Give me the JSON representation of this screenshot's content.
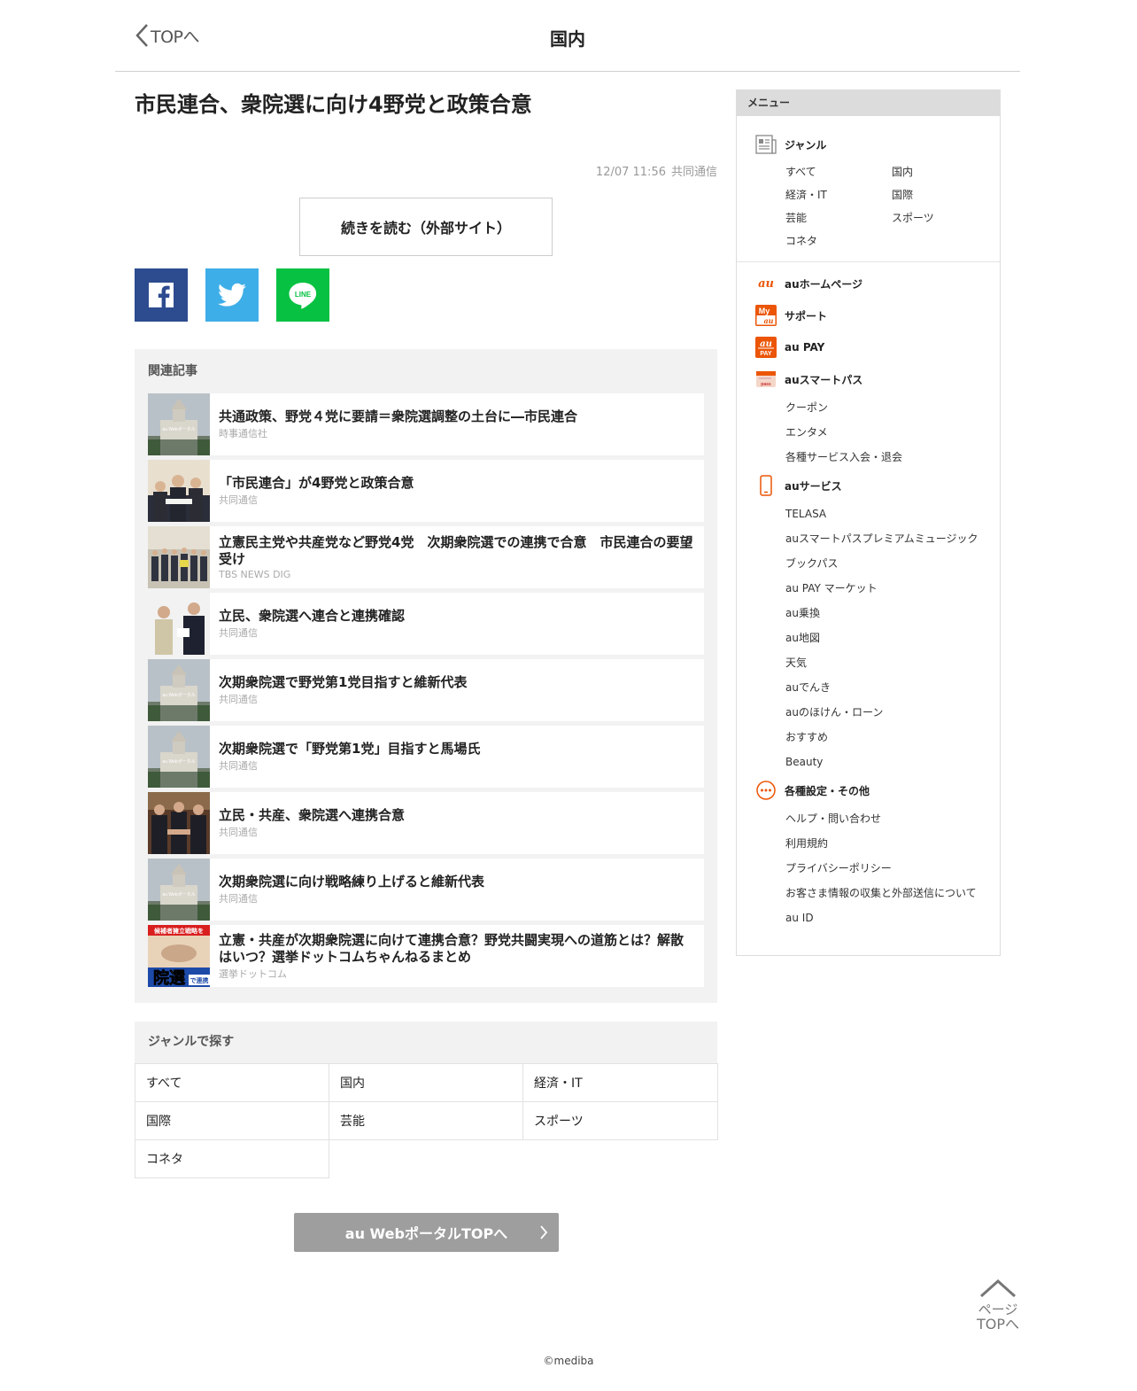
{
  "header": {
    "back_label": "TOPへ",
    "title": "国内"
  },
  "article": {
    "title": "市民連合、衆院選に向け4野党と政策合意",
    "date": "12/07 11:56",
    "source": "共同通信",
    "read_more": "続きを読む（外部サイト）"
  },
  "share": {
    "line_label": "LINE"
  },
  "related": {
    "heading": "関連記事",
    "items": [
      {
        "title": "共通政策、野党４党に要請＝衆院選調整の土台に―市民連合",
        "source": "時事通信社",
        "thumb": "diet"
      },
      {
        "title": "「市民連合」が4野党と政策合意",
        "source": "共同通信",
        "thumb": "people"
      },
      {
        "title": "立憲民主党や共産党など野党4党　次期衆院選での連携で合意　市民連合の要望受け",
        "source": "TBS NEWS DIG",
        "thumb": "group"
      },
      {
        "title": "立民、衆院選へ連合と連携確認",
        "source": "共同通信",
        "thumb": "two"
      },
      {
        "title": "次期衆院選で野党第1党目指すと維新代表",
        "source": "共同通信",
        "thumb": "diet"
      },
      {
        "title": "次期衆院選で「野党第1党」目指すと馬場氏",
        "source": "共同通信",
        "thumb": "diet"
      },
      {
        "title": "立民・共産、衆院選へ連携合意",
        "source": "共同通信",
        "thumb": "handshake"
      },
      {
        "title": "次期衆院選に向け戦略練り上げると維新代表",
        "source": "共同通信",
        "thumb": "diet"
      },
      {
        "title": "立憲・共産が次期衆院選に向けて連携合意？野党共闘実現への道筋とは？解散はいつ？選挙ドットコムちゃんねるまとめ",
        "source": "選挙ドットコム",
        "thumb": "senkyo"
      }
    ],
    "thumb_overlay": "au Webポータル",
    "senkyo_top": "候補者擁立戦略を",
    "senkyo_bottom": "院選",
    "senkyo_tag": "で連携"
  },
  "genre_section": {
    "heading": "ジャンルで探す",
    "cells": [
      "すべて",
      "国内",
      "経済・IT",
      "国際",
      "芸能",
      "スポーツ",
      "コネタ"
    ]
  },
  "portal_button": "au WebポータルTOPへ",
  "sidebar": {
    "heading": "メニュー",
    "genre_title": "ジャンル",
    "genres": [
      "すべて",
      "国内",
      "経済・IT",
      "国際",
      "芸能",
      "スポーツ",
      "コネタ"
    ],
    "links": {
      "homepage": "auホームページ",
      "support": "サポート",
      "aupay": "au PAY",
      "smartpass": "auスマートパス",
      "smartpass_items": [
        "クーポン",
        "エンタメ",
        "各種サービス入会・退会"
      ],
      "services": "auサービス",
      "services_items": [
        "TELASA",
        "auスマートパスプレミアムミュージック",
        "ブックパス",
        "au PAY マーケット",
        "au乗換",
        "au地図",
        "天気",
        "auでんき",
        "auのほけん・ローン",
        "おすすめ",
        "Beauty"
      ],
      "settings": "各種設定・その他",
      "settings_items": [
        "ヘルプ・問い合わせ",
        "利用規約",
        "プライバシーポリシー",
        "お客さま情報の収集と外部送信について",
        "au ID"
      ]
    },
    "icon_text": {
      "au": "au",
      "my": "My",
      "pay_top": "au",
      "pay_bottom": "PAY",
      "pass": "pass"
    }
  },
  "page_top": {
    "line1": "ページ",
    "line2": "TOPへ"
  },
  "footer": "©mediba",
  "colors": {
    "facebook": "#2d4b8f",
    "twitter": "#3eaee8",
    "line": "#06c142",
    "au_orange": "#eb5505"
  }
}
